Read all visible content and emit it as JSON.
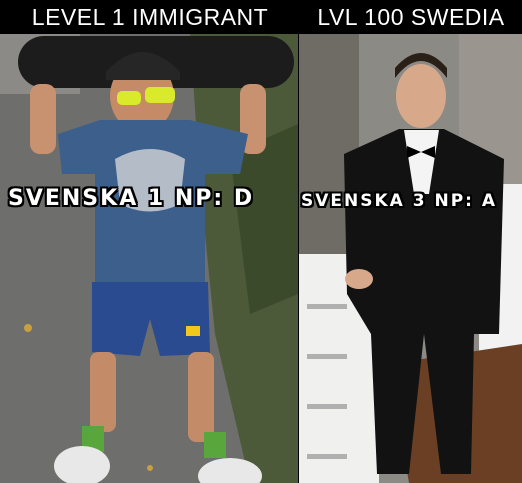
{
  "headers": {
    "left": "LEVEL 1 IMMIGRANT",
    "right": "LVL 100 SWEDIA"
  },
  "captions": {
    "left": "SVENSKA 1 NP: D",
    "right": "SVENSKA 3 NP: A"
  },
  "colors": {
    "shirt_left": "#3c5f8c",
    "shorts_left": "#2a4b8f",
    "socks_left": "#58a63c",
    "sunglasses": "#d8ea2a",
    "asphalt": "#6e6e6c",
    "suit": "#121212",
    "stone_wall": "#8c8a84",
    "wood_floor": "#6b3f24"
  },
  "scene": {
    "left_photo": "boy-with-skateboard-photo",
    "right_photo": "young-man-in-tuxedo-photo"
  }
}
